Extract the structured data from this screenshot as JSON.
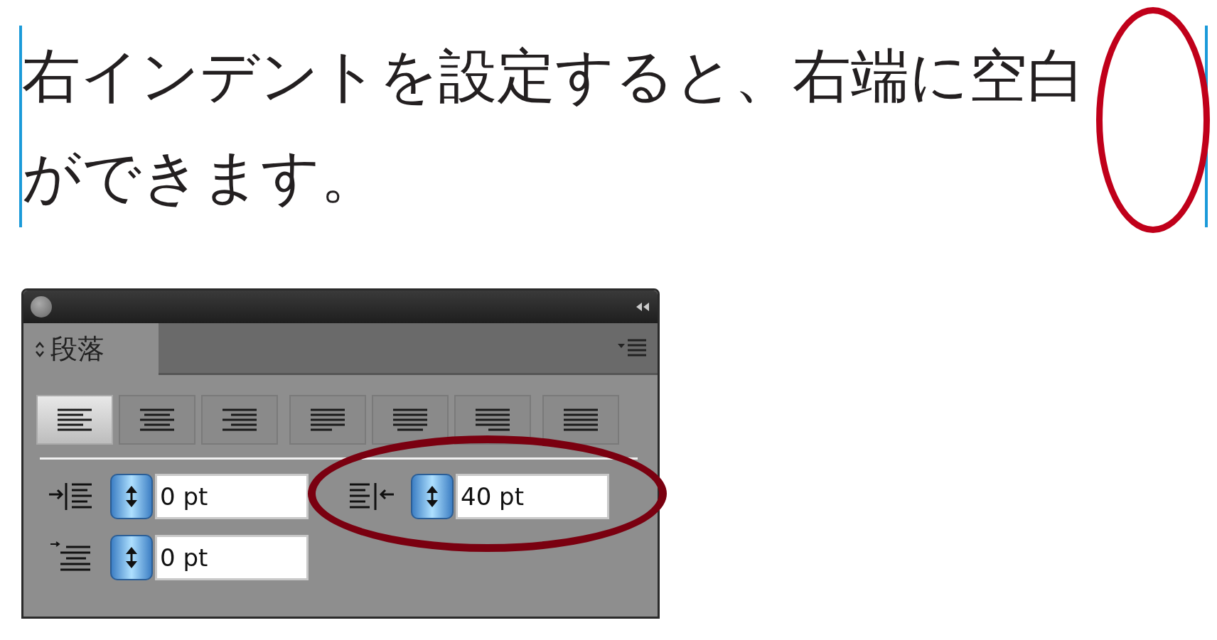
{
  "text": "右インデントを設定すると、右端に空白ができます。",
  "panel": {
    "tab": {
      "label": "段落",
      "selected": true
    },
    "alignment_buttons": [
      {
        "selected": true
      },
      {
        "selected": false
      },
      {
        "selected": false
      },
      {
        "selected": false
      },
      {
        "selected": false
      },
      {
        "selected": false
      },
      {
        "selected": false
      }
    ],
    "left_indent": {
      "value": "0 pt"
    },
    "right_indent": {
      "value": "40 pt"
    },
    "first_line_indent": {
      "value": "0 pt"
    }
  }
}
